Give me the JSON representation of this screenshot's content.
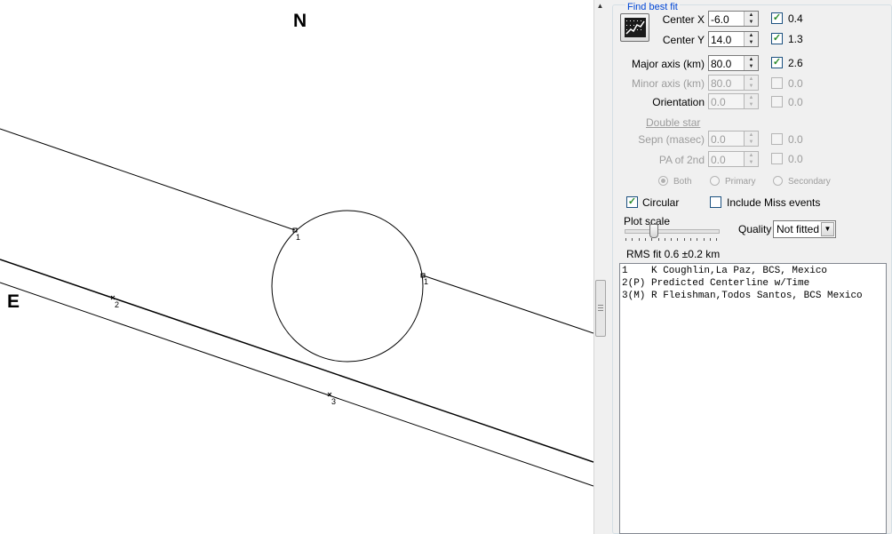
{
  "plot": {
    "compass": {
      "north": "N",
      "east": "E"
    },
    "chord_labels": [
      {
        "id": "1",
        "text": "1"
      },
      {
        "id": "1b",
        "text": "1"
      },
      {
        "id": "2",
        "text": "2"
      },
      {
        "id": "3",
        "text": "3"
      }
    ]
  },
  "panel": {
    "group_title": "Find best fit",
    "fit_button_icon": "fit-graph-icon",
    "params": [
      {
        "key": "center_x",
        "label": "Center X",
        "value": "-6.0",
        "checked": true,
        "check_value": "0.4",
        "enabled": true
      },
      {
        "key": "center_y",
        "label": "Center Y",
        "value": "14.0",
        "checked": true,
        "check_value": "1.3",
        "enabled": true
      },
      {
        "key": "major_axis",
        "label": "Major axis (km)",
        "value": "80.0",
        "checked": true,
        "check_value": "2.6",
        "enabled": true
      },
      {
        "key": "minor_axis",
        "label": "Minor axis (km)",
        "value": "80.0",
        "checked": false,
        "check_value": "0.0",
        "enabled": false
      },
      {
        "key": "orientation",
        "label": "Orientation",
        "value": "0.0",
        "checked": false,
        "check_value": "0.0",
        "enabled": false
      }
    ],
    "double_star": {
      "label": "Double star",
      "params": [
        {
          "key": "sepn",
          "label": "Sepn (masec)",
          "value": "0.0",
          "checked": false,
          "check_value": "0.0"
        },
        {
          "key": "pa_2nd",
          "label": "PA of 2nd",
          "value": "0.0",
          "checked": false,
          "check_value": "0.0"
        }
      ],
      "radios": [
        {
          "label": "Both",
          "selected": true
        },
        {
          "label": "Primary",
          "selected": false
        },
        {
          "label": "Secondary",
          "selected": false
        }
      ]
    },
    "circular": {
      "label": "Circular",
      "checked": true
    },
    "include_miss": {
      "label": "Include Miss events",
      "checked": false
    },
    "plot_scale_label": "Plot scale",
    "plot_scale_value": 0.3,
    "quality_label": "Quality",
    "quality_value": "Not fitted",
    "rms_fit": "RMS fit 0.6 ±0.2 km",
    "observers": [
      {
        "id": "1",
        "text": "1    K Coughlin,La Paz, BCS, Mexico"
      },
      {
        "id": "2",
        "text": "2(P) Predicted Centerline w/Time"
      },
      {
        "id": "3",
        "text": "3(M) R Fleishman,Todos Santos, BCS Mexico"
      }
    ]
  },
  "check_mark": "✓"
}
